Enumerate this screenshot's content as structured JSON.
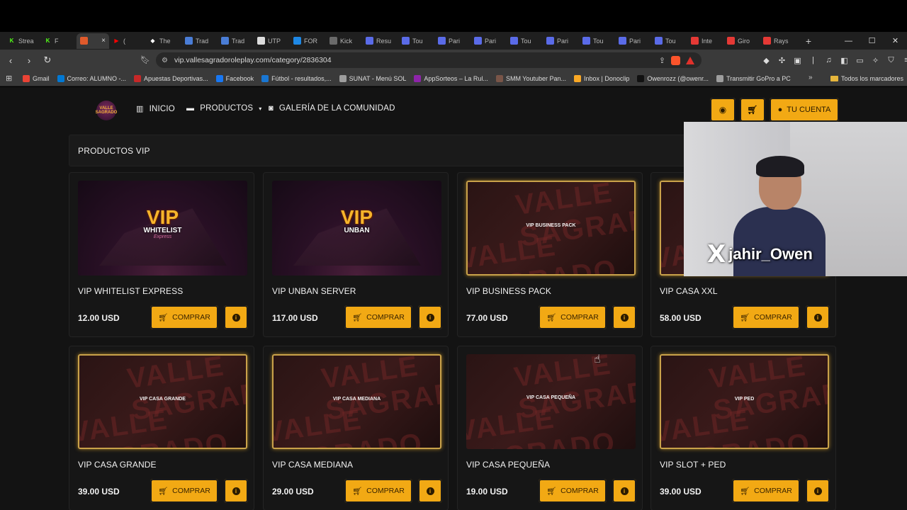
{
  "browser": {
    "tabs": [
      {
        "label": "Strea",
        "color": "#53fc18",
        "glyph": "K"
      },
      {
        "label": "F",
        "color": "#53fc18",
        "glyph": "K"
      },
      {
        "label": "",
        "color": "#e05a2b",
        "glyph": "",
        "active": true
      },
      {
        "label": "(",
        "color": "#ff0000",
        "glyph": "▶"
      },
      {
        "label": "The",
        "color": "#ffffff",
        "glyph": "◆"
      },
      {
        "label": "Trad",
        "color": "#4a7dd6",
        "glyph": ""
      },
      {
        "label": "Trad",
        "color": "#4a7dd6",
        "glyph": ""
      },
      {
        "label": "UTP",
        "color": "#dddddd",
        "glyph": ""
      },
      {
        "label": "FOR",
        "color": "#1e88e5",
        "glyph": ""
      },
      {
        "label": "Kick",
        "color": "#6a6a6a",
        "glyph": ""
      },
      {
        "label": "Resu",
        "color": "#5a6be8",
        "glyph": ""
      },
      {
        "label": "Tou",
        "color": "#5a6be8",
        "glyph": ""
      },
      {
        "label": "Pari",
        "color": "#5a6be8",
        "glyph": ""
      },
      {
        "label": "Pari",
        "color": "#5a6be8",
        "glyph": ""
      },
      {
        "label": "Tou",
        "color": "#5a6be8",
        "glyph": ""
      },
      {
        "label": "Pari",
        "color": "#5a6be8",
        "glyph": ""
      },
      {
        "label": "Tou",
        "color": "#5a6be8",
        "glyph": ""
      },
      {
        "label": "Pari",
        "color": "#5a6be8",
        "glyph": ""
      },
      {
        "label": "Tou",
        "color": "#5a6be8",
        "glyph": ""
      },
      {
        "label": "Inte",
        "color": "#e53935",
        "glyph": ""
      },
      {
        "label": "Giro",
        "color": "#e53935",
        "glyph": ""
      },
      {
        "label": "Rays",
        "color": "#e53935",
        "glyph": ""
      }
    ],
    "active_tab_close": "×",
    "new_tab": "+",
    "url": "vip.vallesagradoroleplay.com/category/2836304",
    "bookmarks": [
      {
        "label": "Gmail",
        "color": "#ea4335"
      },
      {
        "label": "Correo: ALUMNO -...",
        "color": "#0078d4"
      },
      {
        "label": "Apuestas Deportivas...",
        "color": "#c62828"
      },
      {
        "label": "Facebook",
        "color": "#1877f2"
      },
      {
        "label": "Fútbol - resultados,...",
        "color": "#1976d2"
      },
      {
        "label": "SUNAT - Menú SOL",
        "color": "#9e9e9e"
      },
      {
        "label": "AppSorteos – La Rul...",
        "color": "#8e24aa"
      },
      {
        "label": "SMM Youtuber Pan...",
        "color": "#795548"
      },
      {
        "label": "Inbox | Donoclip",
        "color": "#f9a825"
      },
      {
        "label": "Owenrozz (@owenr...",
        "color": "#111111"
      },
      {
        "label": "Transmitir GoPro a PC",
        "color": "#9e9e9e"
      }
    ],
    "bookmarks_more": "»",
    "all_bookmarks": "Todos los marcadores"
  },
  "site": {
    "logo_text": "VALLE SAGRADO",
    "nav": {
      "home": "INICIO",
      "products": "PRODUCTOS",
      "gallery": "GALERÍA DE LA COMUNIDAD"
    },
    "account": "TU CUENTA",
    "section_title": "PRODUCTOS VIP",
    "buy_label": "COMPRAR",
    "watermark": "VALLE SAGRADO",
    "products": [
      {
        "title": "VIP WHITELIST EXPRESS",
        "price": "12.00 USD",
        "art": "vip",
        "badge_top": "VIP",
        "badge_bottom": "WHITELIST",
        "badge_sub": "Express"
      },
      {
        "title": "VIP UNBAN SERVER",
        "price": "117.00 USD",
        "art": "vip",
        "badge_top": "VIP",
        "badge_bottom": "UNBAN",
        "badge_sub": ""
      },
      {
        "title": "VIP BUSINESS PACK",
        "price": "77.00 USD",
        "art": "brand",
        "label": "VIP BUSINESS PACK"
      },
      {
        "title": "VIP CASA XXL",
        "price": "58.00 USD",
        "art": "brand",
        "label": ""
      },
      {
        "title": "VIP CASA GRANDE",
        "price": "39.00 USD",
        "art": "brand",
        "label": "VIP CASA GRANDE"
      },
      {
        "title": "VIP CASA MEDIANA",
        "price": "29.00 USD",
        "art": "brand",
        "label": "VIP CASA MEDIANA"
      },
      {
        "title": "VIP CASA PEQUEÑA",
        "price": "19.00 USD",
        "art": "brand-plain",
        "label": "VIP CASA PEQUEÑA"
      },
      {
        "title": "VIP SLOT + PED",
        "price": "39.00 USD",
        "art": "brand",
        "label": "VIP PED"
      }
    ]
  },
  "overlay": {
    "handle": "jahir_Owen",
    "platform_icon": "X"
  },
  "colors": {
    "accent": "#f2a914",
    "page_bg": "#131313",
    "card_bg": "#161616"
  }
}
